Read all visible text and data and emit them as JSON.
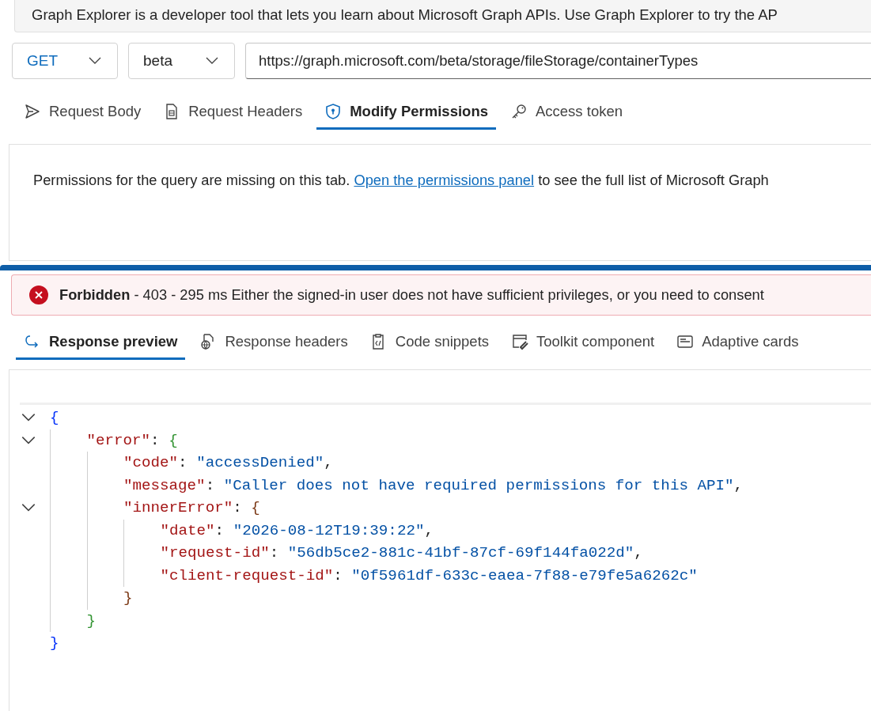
{
  "banner": {
    "text": "Graph Explorer is a developer tool that lets you learn about Microsoft Graph APIs. Use Graph Explorer to try the AP"
  },
  "query": {
    "method": "GET",
    "version": "beta",
    "url": "https://graph.microsoft.com/beta/storage/fileStorage/containerTypes"
  },
  "request_tabs": [
    {
      "label": "Request Body",
      "selected": false
    },
    {
      "label": "Request Headers",
      "selected": false
    },
    {
      "label": "Modify Permissions",
      "selected": true
    },
    {
      "label": "Access token",
      "selected": false
    }
  ],
  "permissions_panel": {
    "before": "Permissions for the query are missing on this tab. ",
    "link": "Open the permissions panel",
    "after": " to see the full list of Microsoft Graph"
  },
  "status": {
    "message": "**Forbidden** - 403 - 295 ms Either the signed-in user does not have sufficient privileges, or you need to consent"
  },
  "response_tabs": [
    {
      "label": "Response preview",
      "selected": true
    },
    {
      "label": "Response headers",
      "selected": false
    },
    {
      "label": "Code snippets",
      "selected": false
    },
    {
      "label": "Toolkit component",
      "selected": false
    },
    {
      "label": "Adaptive cards",
      "selected": false
    }
  ],
  "code": {
    "open": "{",
    "close": "}",
    "expanded": true,
    "children": [
      {
        "key": "\"error\"",
        "colon": ":",
        "open": "{",
        "close": "}",
        "expanded": true,
        "children": [
          {
            "key": "\"code\"",
            "colon": ":",
            "value": "\"accessDenied\"",
            "comma": ","
          },
          {
            "key": "\"message\"",
            "colon": ":",
            "value": "\"Caller does not have required permissions for this API\"",
            "comma": ","
          },
          {
            "key": "\"innerError\"",
            "colon": ":",
            "open": "{",
            "close": "}",
            "expanded": true,
            "children": [
              {
                "key": "\"date\"",
                "colon": ":",
                "value": "\"2026-08-12T19:39:22\"",
                "comma": ","
              },
              {
                "key": "\"request-id\"",
                "colon": ":",
                "value": "\"56db5ce2-881c-41bf-87cf-69f144fa022d\"",
                "comma": ","
              },
              {
                "key": "\"client-request-id\"",
                "colon": ":",
                "value": "\"0f5961df-633c-eaea-7f88-e79fe5a6262c\""
              }
            ]
          }
        ]
      }
    ]
  }
}
